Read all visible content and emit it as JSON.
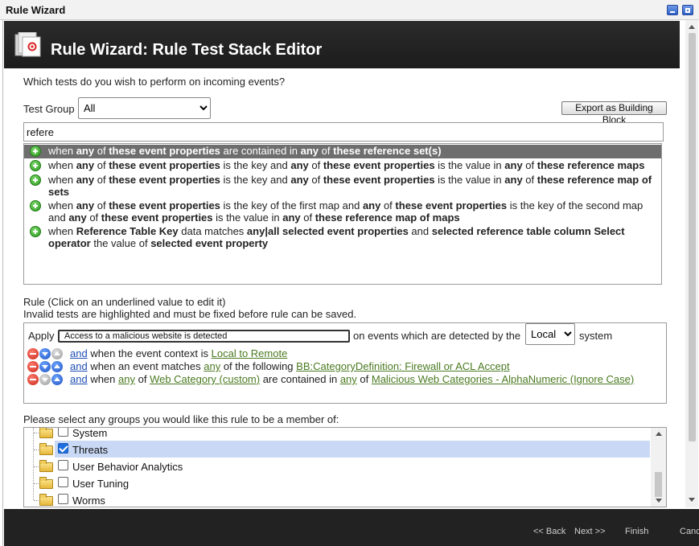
{
  "window": {
    "title": "Rule Wizard"
  },
  "header": {
    "title": "Rule Wizard: Rule Test Stack Editor"
  },
  "question": "Which tests do you wish to perform on incoming events?",
  "test_group": {
    "label": "Test Group",
    "selected": "All"
  },
  "export_button": "Export as Building Block",
  "search": {
    "value": "refere"
  },
  "tests": [
    {
      "segments": [
        [
          "when ",
          false
        ],
        [
          "any",
          true
        ],
        [
          " of ",
          false
        ],
        [
          "these event properties",
          true
        ],
        [
          " are contained in ",
          false
        ],
        [
          "any",
          true
        ],
        [
          " of ",
          false
        ],
        [
          "these reference set(s)",
          true
        ]
      ],
      "selected": true
    },
    {
      "segments": [
        [
          "when ",
          false
        ],
        [
          "any",
          true
        ],
        [
          " of ",
          false
        ],
        [
          "these event properties",
          true
        ],
        [
          " is the key and ",
          false
        ],
        [
          "any",
          true
        ],
        [
          " of ",
          false
        ],
        [
          "these event properties",
          true
        ],
        [
          " is the value in ",
          false
        ],
        [
          "any",
          true
        ],
        [
          " of ",
          false
        ],
        [
          "these reference maps",
          true
        ]
      ],
      "selected": false
    },
    {
      "segments": [
        [
          "when ",
          false
        ],
        [
          "any",
          true
        ],
        [
          " of ",
          false
        ],
        [
          "these event properties",
          true
        ],
        [
          " is the key and ",
          false
        ],
        [
          "any",
          true
        ],
        [
          " of ",
          false
        ],
        [
          "these event properties",
          true
        ],
        [
          " is the value in ",
          false
        ],
        [
          "any",
          true
        ],
        [
          " of ",
          false
        ],
        [
          "these reference map of sets",
          true
        ]
      ],
      "selected": false
    },
    {
      "segments": [
        [
          "when ",
          false
        ],
        [
          "any",
          true
        ],
        [
          " of ",
          false
        ],
        [
          "these event properties",
          true
        ],
        [
          " is the key of the first map and ",
          false
        ],
        [
          "any",
          true
        ],
        [
          " of ",
          false
        ],
        [
          "these event properties",
          true
        ],
        [
          " is the key of the second map and ",
          false
        ],
        [
          "any",
          true
        ],
        [
          " of ",
          false
        ],
        [
          "these event properties",
          true
        ],
        [
          " is the value in ",
          false
        ],
        [
          "any",
          true
        ],
        [
          " of ",
          false
        ],
        [
          "these reference map of maps",
          true
        ]
      ],
      "selected": false
    },
    {
      "segments": [
        [
          "when ",
          false
        ],
        [
          "Reference Table Key",
          true
        ],
        [
          " data matches ",
          false
        ],
        [
          "any|all selected event properties",
          true
        ],
        [
          " and ",
          false
        ],
        [
          "selected reference table column Select operator",
          true
        ],
        [
          " the value of ",
          false
        ],
        [
          "selected event property",
          true
        ]
      ],
      "selected": false
    }
  ],
  "rule": {
    "heading": "Rule (Click on an underlined value to edit it)",
    "note": "Invalid tests are highlighted and must be fixed before rule can be saved.",
    "apply_label": "Apply",
    "name": "Access to a malicious website is detected",
    "on_events": "on events which are detected by the",
    "system_select": "Local",
    "system_label": "system",
    "lines": [
      {
        "parts": [
          [
            "and",
            "and"
          ],
          [
            " when the event context is ",
            "t"
          ],
          [
            "Local to Remote",
            "l"
          ]
        ]
      },
      {
        "parts": [
          [
            "and",
            "and"
          ],
          [
            " when an event matches ",
            "t"
          ],
          [
            "any",
            "l"
          ],
          [
            " of the following ",
            "t"
          ],
          [
            "BB:CategoryDefinition: Firewall or ACL Accept",
            "l"
          ]
        ]
      },
      {
        "parts": [
          [
            "and",
            "and"
          ],
          [
            " when ",
            "t"
          ],
          [
            "any",
            "l"
          ],
          [
            " of ",
            "t"
          ],
          [
            "Web Category (custom)",
            "l"
          ],
          [
            " are contained in ",
            "t"
          ],
          [
            "any",
            "l"
          ],
          [
            " of ",
            "t"
          ],
          [
            "Malicious Web Categories - AlphaNumeric (Ignore Case)",
            "l"
          ]
        ]
      }
    ]
  },
  "groups_prompt": "Please select any groups you would like this rule to be a member of:",
  "groups": [
    {
      "name": "System",
      "checked": false
    },
    {
      "name": "Threats",
      "checked": true
    },
    {
      "name": "User Behavior Analytics",
      "checked": false
    },
    {
      "name": "User Tuning",
      "checked": false
    },
    {
      "name": "Worms",
      "checked": false
    }
  ],
  "footer": {
    "back": "<< Back",
    "next": "Next >>",
    "finish": "Finish",
    "cancel": "Cancel"
  }
}
